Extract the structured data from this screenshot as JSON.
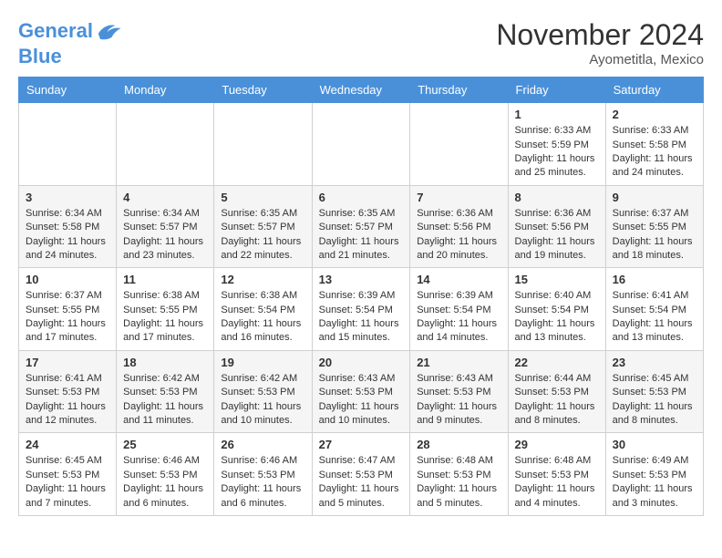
{
  "header": {
    "logo_line1": "General",
    "logo_line2": "Blue",
    "month": "November 2024",
    "location": "Ayometitla, Mexico"
  },
  "days_of_week": [
    "Sunday",
    "Monday",
    "Tuesday",
    "Wednesday",
    "Thursday",
    "Friday",
    "Saturday"
  ],
  "weeks": [
    [
      {
        "day": "",
        "info": ""
      },
      {
        "day": "",
        "info": ""
      },
      {
        "day": "",
        "info": ""
      },
      {
        "day": "",
        "info": ""
      },
      {
        "day": "",
        "info": ""
      },
      {
        "day": "1",
        "info": "Sunrise: 6:33 AM\nSunset: 5:59 PM\nDaylight: 11 hours and 25 minutes."
      },
      {
        "day": "2",
        "info": "Sunrise: 6:33 AM\nSunset: 5:58 PM\nDaylight: 11 hours and 24 minutes."
      }
    ],
    [
      {
        "day": "3",
        "info": "Sunrise: 6:34 AM\nSunset: 5:58 PM\nDaylight: 11 hours and 24 minutes."
      },
      {
        "day": "4",
        "info": "Sunrise: 6:34 AM\nSunset: 5:57 PM\nDaylight: 11 hours and 23 minutes."
      },
      {
        "day": "5",
        "info": "Sunrise: 6:35 AM\nSunset: 5:57 PM\nDaylight: 11 hours and 22 minutes."
      },
      {
        "day": "6",
        "info": "Sunrise: 6:35 AM\nSunset: 5:57 PM\nDaylight: 11 hours and 21 minutes."
      },
      {
        "day": "7",
        "info": "Sunrise: 6:36 AM\nSunset: 5:56 PM\nDaylight: 11 hours and 20 minutes."
      },
      {
        "day": "8",
        "info": "Sunrise: 6:36 AM\nSunset: 5:56 PM\nDaylight: 11 hours and 19 minutes."
      },
      {
        "day": "9",
        "info": "Sunrise: 6:37 AM\nSunset: 5:55 PM\nDaylight: 11 hours and 18 minutes."
      }
    ],
    [
      {
        "day": "10",
        "info": "Sunrise: 6:37 AM\nSunset: 5:55 PM\nDaylight: 11 hours and 17 minutes."
      },
      {
        "day": "11",
        "info": "Sunrise: 6:38 AM\nSunset: 5:55 PM\nDaylight: 11 hours and 17 minutes."
      },
      {
        "day": "12",
        "info": "Sunrise: 6:38 AM\nSunset: 5:54 PM\nDaylight: 11 hours and 16 minutes."
      },
      {
        "day": "13",
        "info": "Sunrise: 6:39 AM\nSunset: 5:54 PM\nDaylight: 11 hours and 15 minutes."
      },
      {
        "day": "14",
        "info": "Sunrise: 6:39 AM\nSunset: 5:54 PM\nDaylight: 11 hours and 14 minutes."
      },
      {
        "day": "15",
        "info": "Sunrise: 6:40 AM\nSunset: 5:54 PM\nDaylight: 11 hours and 13 minutes."
      },
      {
        "day": "16",
        "info": "Sunrise: 6:41 AM\nSunset: 5:54 PM\nDaylight: 11 hours and 13 minutes."
      }
    ],
    [
      {
        "day": "17",
        "info": "Sunrise: 6:41 AM\nSunset: 5:53 PM\nDaylight: 11 hours and 12 minutes."
      },
      {
        "day": "18",
        "info": "Sunrise: 6:42 AM\nSunset: 5:53 PM\nDaylight: 11 hours and 11 minutes."
      },
      {
        "day": "19",
        "info": "Sunrise: 6:42 AM\nSunset: 5:53 PM\nDaylight: 11 hours and 10 minutes."
      },
      {
        "day": "20",
        "info": "Sunrise: 6:43 AM\nSunset: 5:53 PM\nDaylight: 11 hours and 10 minutes."
      },
      {
        "day": "21",
        "info": "Sunrise: 6:43 AM\nSunset: 5:53 PM\nDaylight: 11 hours and 9 minutes."
      },
      {
        "day": "22",
        "info": "Sunrise: 6:44 AM\nSunset: 5:53 PM\nDaylight: 11 hours and 8 minutes."
      },
      {
        "day": "23",
        "info": "Sunrise: 6:45 AM\nSunset: 5:53 PM\nDaylight: 11 hours and 8 minutes."
      }
    ],
    [
      {
        "day": "24",
        "info": "Sunrise: 6:45 AM\nSunset: 5:53 PM\nDaylight: 11 hours and 7 minutes."
      },
      {
        "day": "25",
        "info": "Sunrise: 6:46 AM\nSunset: 5:53 PM\nDaylight: 11 hours and 6 minutes."
      },
      {
        "day": "26",
        "info": "Sunrise: 6:46 AM\nSunset: 5:53 PM\nDaylight: 11 hours and 6 minutes."
      },
      {
        "day": "27",
        "info": "Sunrise: 6:47 AM\nSunset: 5:53 PM\nDaylight: 11 hours and 5 minutes."
      },
      {
        "day": "28",
        "info": "Sunrise: 6:48 AM\nSunset: 5:53 PM\nDaylight: 11 hours and 5 minutes."
      },
      {
        "day": "29",
        "info": "Sunrise: 6:48 AM\nSunset: 5:53 PM\nDaylight: 11 hours and 4 minutes."
      },
      {
        "day": "30",
        "info": "Sunrise: 6:49 AM\nSunset: 5:53 PM\nDaylight: 11 hours and 3 minutes."
      }
    ]
  ]
}
